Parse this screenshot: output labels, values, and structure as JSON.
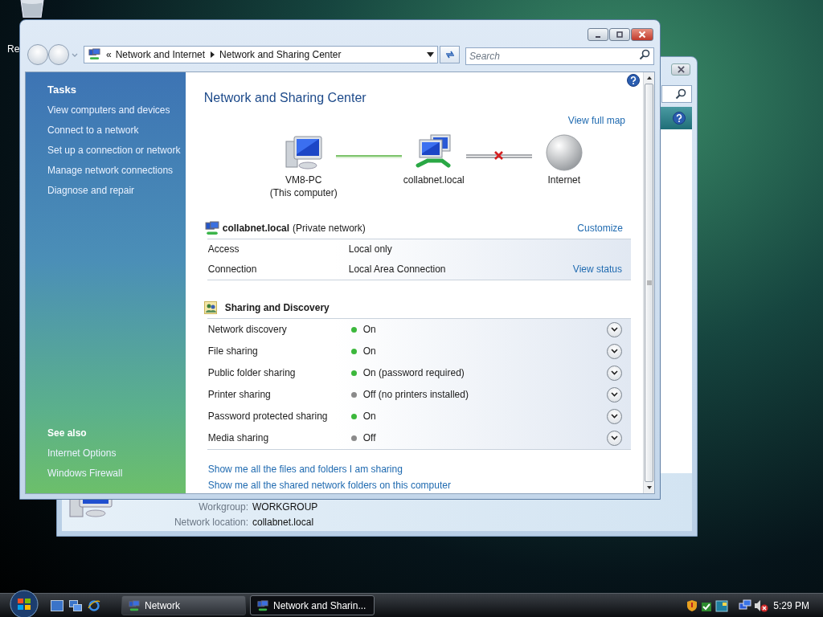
{
  "desktop": {
    "icon_labels": [
      "Re"
    ]
  },
  "background_window": {
    "details": [
      {
        "label": "Workgroup:",
        "value": "WORKGROUP"
      },
      {
        "label": "Network location:",
        "value": "collabnet.local"
      }
    ]
  },
  "window": {
    "address": {
      "overflow": "«",
      "crumbs": [
        "Network and Internet",
        "Network and Sharing Center"
      ]
    },
    "search": {
      "placeholder": "Search"
    },
    "tasks": {
      "heading": "Tasks",
      "items": [
        "View computers and devices",
        "Connect to a network",
        "Set up a connection or network",
        "Manage network connections",
        "Diagnose and repair"
      ]
    },
    "see_also": {
      "heading": "See also",
      "items": [
        "Internet Options",
        "Windows Firewall"
      ]
    },
    "title": "Network and Sharing Center",
    "view_full_map": "View full map",
    "map": {
      "nodes": [
        {
          "kind": "computer",
          "name": "VM8-PC",
          "subtitle": "(This computer)"
        },
        {
          "kind": "network",
          "name": "collabnet.local"
        },
        {
          "kind": "internet",
          "name": "Internet"
        }
      ],
      "links": [
        {
          "connected": true
        },
        {
          "connected": false
        }
      ]
    },
    "network": {
      "name": "collabnet.local",
      "type": "(Private network)",
      "action": "Customize",
      "rows": [
        {
          "label": "Access",
          "value": "Local only"
        },
        {
          "label": "Connection",
          "value": "Local Area Connection",
          "link": "View status"
        }
      ]
    },
    "sharing": {
      "heading": "Sharing and Discovery",
      "rows": [
        {
          "label": "Network discovery",
          "value": "On",
          "on": true
        },
        {
          "label": "File sharing",
          "value": "On",
          "on": true
        },
        {
          "label": "Public folder sharing",
          "value": "On (password required)",
          "on": true
        },
        {
          "label": "Printer sharing",
          "value": "Off (no printers installed)",
          "on": false
        },
        {
          "label": "Password protected sharing",
          "value": "On",
          "on": true
        },
        {
          "label": "Media sharing",
          "value": "Off",
          "on": false
        }
      ]
    },
    "links": [
      "Show me all the files and folders I am sharing",
      "Show me all the shared network folders on this computer"
    ]
  },
  "taskbar": {
    "buttons": [
      {
        "label": "Network",
        "selected": false
      },
      {
        "label": "Network and Sharin...",
        "selected": true
      }
    ],
    "clock": "5:29 PM"
  }
}
